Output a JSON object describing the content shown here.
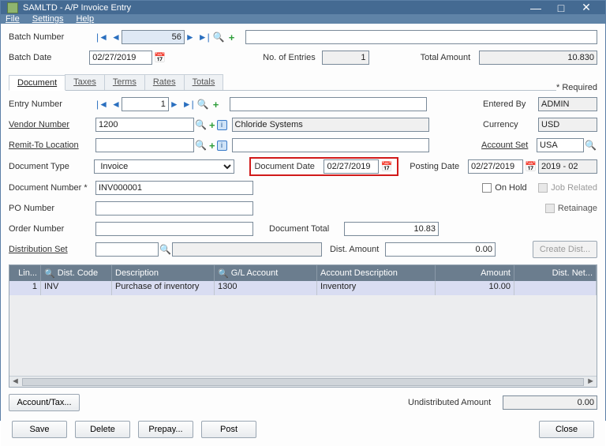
{
  "window": {
    "title": "SAMLTD - A/P Invoice Entry",
    "menu": {
      "file": "File",
      "settings": "Settings",
      "help": "Help"
    }
  },
  "header": {
    "batch_number_label": "Batch Number",
    "batch_number": "56",
    "batch_desc": "",
    "batch_date_label": "Batch Date",
    "batch_date": "02/27/2019",
    "no_entries_label": "No. of Entries",
    "no_entries": "1",
    "total_amount_label": "Total Amount",
    "total_amount": "10.830",
    "required_note": "* Required"
  },
  "tabs": {
    "document": "Document",
    "taxes": "Taxes",
    "terms": "Terms",
    "rates": "Rates",
    "totals": "Totals"
  },
  "doc": {
    "entry_number_label": "Entry Number",
    "entry_number": "1",
    "entry_desc": "",
    "entered_by_label": "Entered By",
    "entered_by": "ADMIN",
    "vendor_number_label": "Vendor Number",
    "vendor_number": "1200",
    "vendor_name": "Chloride Systems",
    "currency_label": "Currency",
    "currency": "USD",
    "remit_to_label": "Remit-To Location",
    "remit_to": "",
    "remit_to_desc": "",
    "account_set_label": "Account Set",
    "account_set": "USA",
    "document_type_label": "Document Type",
    "document_type": "Invoice",
    "document_date_label": "Document Date",
    "document_date": "02/27/2019",
    "posting_date_label": "Posting Date",
    "posting_date": "02/27/2019",
    "period": "2019 - 02",
    "document_number_label": "Document Number *",
    "document_number": "INV000001",
    "on_hold_label": "On Hold",
    "job_related_label": "Job Related",
    "po_number_label": "PO Number",
    "po_number": "",
    "retainage_label": "Retainage",
    "order_number_label": "Order Number",
    "order_number": "",
    "document_total_label": "Document Total",
    "document_total": "10.83",
    "distribution_set_label": "Distribution Set",
    "distribution_set": "",
    "dist_amount_label": "Dist. Amount",
    "dist_amount": "0.00",
    "create_dist_btn": "Create Dist..."
  },
  "grid": {
    "cols": {
      "line": "Lin...",
      "dist_code": "Dist. Code",
      "description": "Description",
      "gl_account": "G/L Account",
      "account_desc": "Account Description",
      "amount": "Amount",
      "dist_net": "Dist. Net..."
    },
    "rows": [
      {
        "line": "1",
        "dist_code": "INV",
        "description": "Purchase of inventory",
        "gl_account": "1300",
        "account_desc": "Inventory",
        "amount": "10.00",
        "dist_net": ""
      }
    ]
  },
  "footer": {
    "account_tax_btn": "Account/Tax...",
    "undist_label": "Undistributed Amount",
    "undist_amount": "0.00",
    "save": "Save",
    "delete": "Delete",
    "prepay": "Prepay...",
    "post": "Post",
    "close": "Close"
  }
}
